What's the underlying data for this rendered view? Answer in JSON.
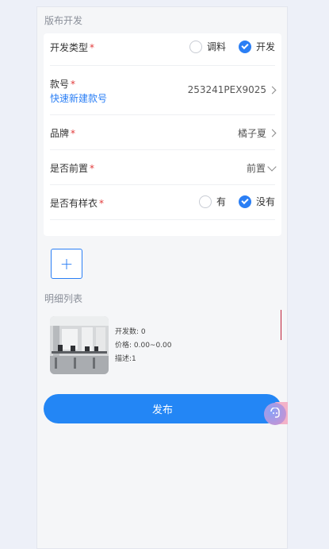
{
  "form": {
    "section_title": "版布开发",
    "dev_type": {
      "label": "开发类型",
      "required": "*",
      "options": [
        "调料",
        "开发"
      ],
      "selected": "开发"
    },
    "style_no": {
      "label": "款号",
      "required": "*",
      "link": "快速新建款号",
      "value": "253241PEX9025"
    },
    "brand": {
      "label": "品牌",
      "required": "*",
      "value": "橘子夏"
    },
    "front": {
      "label": "是否前置",
      "required": "*",
      "value": "前置"
    },
    "sample": {
      "label": "是否有样衣",
      "required": "*",
      "options": [
        "有",
        "没有"
      ],
      "selected": "没有"
    }
  },
  "add_button": {
    "symbol": "+"
  },
  "detail": {
    "title": "明细列表",
    "item": {
      "count": "开发数: 0",
      "price": "价格: 0.00~0.00",
      "desc": "描述:1"
    }
  },
  "publish_button": {
    "label": "发布"
  },
  "colors": {
    "accent": "#2386f5",
    "required": "#e23b3b"
  }
}
